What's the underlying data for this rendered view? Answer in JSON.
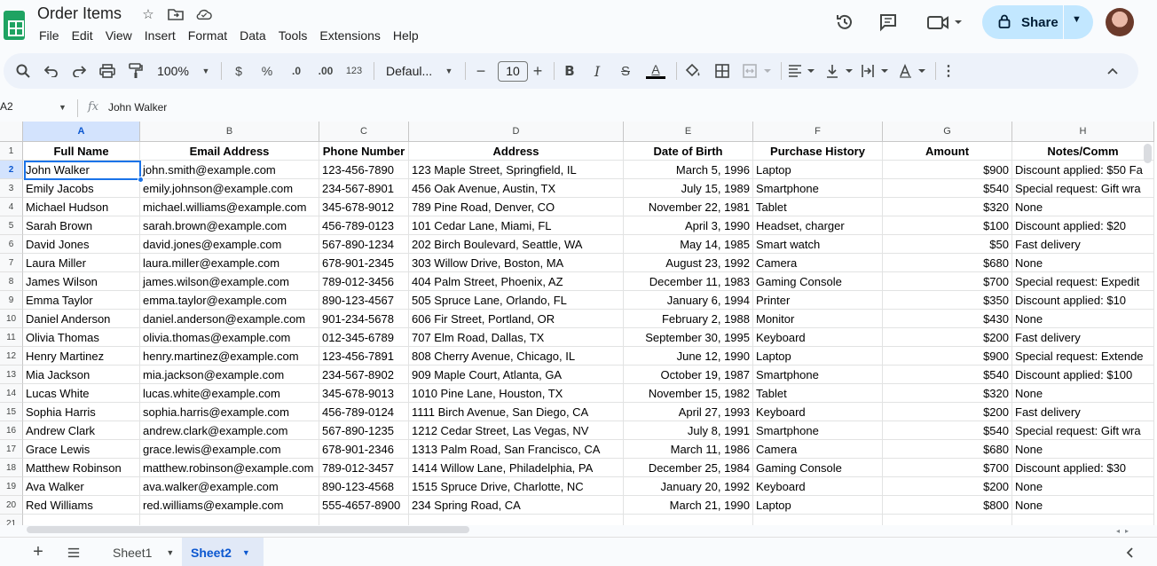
{
  "doc": {
    "title": "Order Items"
  },
  "menu": [
    "File",
    "Edit",
    "View",
    "Insert",
    "Format",
    "Data",
    "Tools",
    "Extensions",
    "Help"
  ],
  "header": {
    "share_label": "Share"
  },
  "toolbar": {
    "zoom": "100%",
    "currency": "$",
    "percent": "%",
    "dec_decrease": ".0",
    "dec_increase": ".00",
    "format_123": "123",
    "font": "Defaul...",
    "font_size": "10"
  },
  "formula_bar": {
    "cell_ref": "A2",
    "fx": "fx",
    "value": "John Walker"
  },
  "grid": {
    "columns": [
      "A",
      "B",
      "C",
      "D",
      "E",
      "F",
      "G",
      "H"
    ],
    "headers": [
      "Full Name",
      "Email Address",
      "Phone Number",
      "Address",
      "Date of Birth",
      "Purchase History",
      "Amount",
      "Notes/Comm"
    ],
    "row_numbers": [
      "1",
      "2",
      "3",
      "4",
      "5",
      "6",
      "7",
      "8",
      "9",
      "10",
      "11",
      "12",
      "13",
      "14",
      "15",
      "16",
      "17",
      "18",
      "19",
      "20",
      "21"
    ],
    "rows": [
      [
        "John Walker",
        "john.smith@example.com",
        "123-456-7890",
        "123 Maple Street, Springfield, IL",
        "March 5, 1996",
        "Laptop",
        "$900",
        "Discount applied: $50 Fa"
      ],
      [
        "Emily Jacobs",
        "emily.johnson@example.com",
        "234-567-8901",
        "456 Oak Avenue, Austin, TX",
        "July 15, 1989",
        "Smartphone",
        "$540",
        "Special request: Gift wra"
      ],
      [
        "Michael Hudson",
        "michael.williams@example.com",
        "345-678-9012",
        "789 Pine Road, Denver, CO",
        "November 22, 1981",
        "Tablet",
        "$320",
        "None"
      ],
      [
        "Sarah Brown",
        "sarah.brown@example.com",
        "456-789-0123",
        "101 Cedar Lane, Miami, FL",
        "April 3, 1990",
        "Headset, charger",
        "$100",
        "Discount applied: $20"
      ],
      [
        "David Jones",
        "david.jones@example.com",
        "567-890-1234",
        "202 Birch Boulevard, Seattle, WA",
        "May 14, 1985",
        "Smart watch",
        "$50",
        "Fast delivery"
      ],
      [
        "Laura Miller",
        "laura.miller@example.com",
        "678-901-2345",
        "303 Willow Drive, Boston, MA",
        "August 23, 1992",
        "Camera",
        "$680",
        "None"
      ],
      [
        "James Wilson",
        "james.wilson@example.com",
        "789-012-3456",
        "404 Palm Street, Phoenix, AZ",
        "December 11, 1983",
        "Gaming Console",
        "$700",
        "Special request: Expedit"
      ],
      [
        "Emma Taylor",
        "emma.taylor@example.com",
        "890-123-4567",
        "505 Spruce Lane, Orlando, FL",
        "January 6, 1994",
        "Printer",
        "$350",
        "Discount applied: $10"
      ],
      [
        "Daniel Anderson",
        "daniel.anderson@example.com",
        "901-234-5678",
        "606 Fir Street, Portland, OR",
        "February 2, 1988",
        "Monitor",
        "$430",
        "None"
      ],
      [
        "Olivia Thomas",
        "olivia.thomas@example.com",
        "012-345-6789",
        "707 Elm Road, Dallas, TX",
        "September 30, 1995",
        "Keyboard",
        "$200",
        "Fast delivery"
      ],
      [
        "Henry Martinez",
        "henry.martinez@example.com",
        "123-456-7891",
        "808 Cherry Avenue, Chicago, IL",
        "June 12, 1990",
        "Laptop",
        "$900",
        "Special request: Extende"
      ],
      [
        "Mia Jackson",
        "mia.jackson@example.com",
        "234-567-8902",
        "909 Maple Court, Atlanta, GA",
        "October 19, 1987",
        "Smartphone",
        "$540",
        "Discount applied: $100"
      ],
      [
        "Lucas White",
        "lucas.white@example.com",
        "345-678-9013",
        "1010 Pine Lane, Houston, TX",
        "November 15, 1982",
        "Tablet",
        "$320",
        "None"
      ],
      [
        "Sophia Harris",
        "sophia.harris@example.com",
        "456-789-0124",
        "1111 Birch Avenue, San Diego, CA",
        "April 27, 1993",
        "Keyboard",
        "$200",
        "Fast delivery"
      ],
      [
        "Andrew Clark",
        "andrew.clark@example.com",
        "567-890-1235",
        "1212 Cedar Street, Las Vegas, NV",
        "July 8, 1991",
        "Smartphone",
        "$540",
        "Special request: Gift wra"
      ],
      [
        "Grace Lewis",
        "grace.lewis@example.com",
        "678-901-2346",
        "1313 Palm Road, San Francisco, CA",
        "March 11, 1986",
        "Camera",
        "$680",
        "None"
      ],
      [
        "Matthew Robinson",
        "matthew.robinson@example.com",
        "789-012-3457",
        "1414 Willow Lane, Philadelphia, PA",
        "December 25, 1984",
        "Gaming Console",
        "$700",
        "Discount applied: $30"
      ],
      [
        "Ava Walker",
        "ava.walker@example.com",
        "890-123-4568",
        "1515 Spruce Drive, Charlotte, NC",
        "January 20, 1992",
        "Keyboard",
        "$200",
        "None"
      ],
      [
        "Red Williams",
        "red.williams@example.com",
        "555-4657-8900",
        "234 Spring Road, CA",
        "March 21, 1990",
        "Laptop",
        "$800",
        "None"
      ]
    ]
  },
  "sheets": {
    "tab1": "Sheet1",
    "tab2": "Sheet2"
  },
  "colors": {
    "accent": "#0b57d0",
    "share_bg": "#c2e7ff",
    "selection": "#1a73e8",
    "sheets_green": "#1ea362"
  }
}
